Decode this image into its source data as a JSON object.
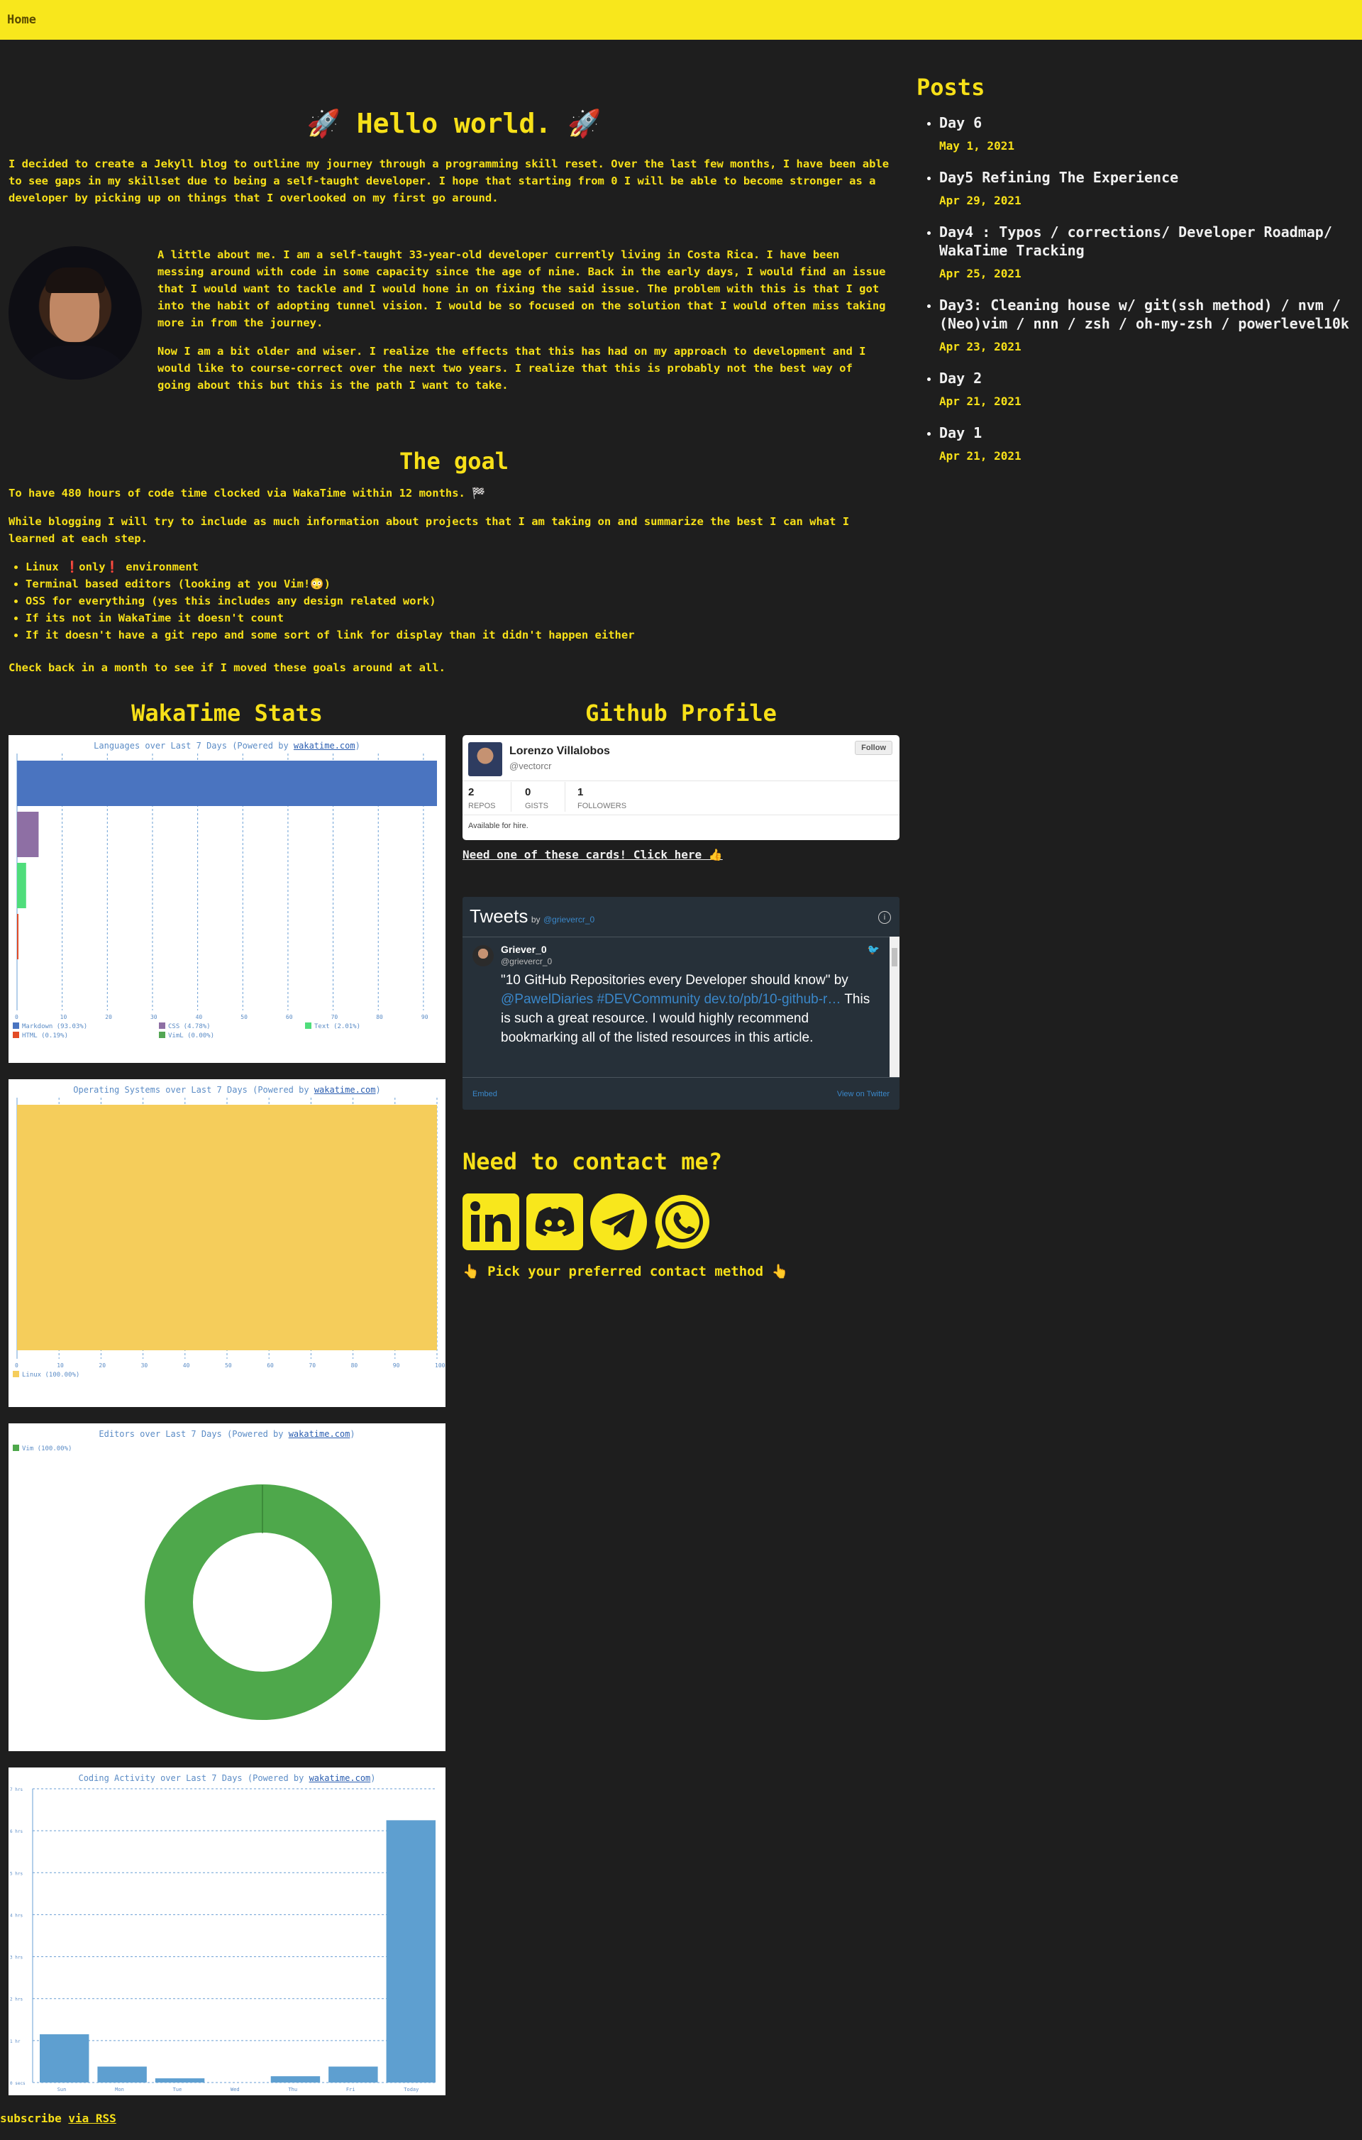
{
  "nav": {
    "home_label": "Home"
  },
  "main": {
    "title": "🚀 Hello world. 🚀",
    "intro": "I decided to create a Jekyll blog to outline my journey through a programming skill reset. Over the last few months, I have been able to see gaps in my skillset due to being a self-taught developer. I hope that starting from 0 I will be able to become stronger as a developer by picking up on things that I overlooked on my first go around.",
    "about_1": "A little about me. I am a self-taught 33-year-old developer currently living in Costa Rica. I have been messing around with code in some capacity since the age of nine. Back in the early days, I would find an issue that I would want to tackle and I would hone in on fixing the said issue. The problem with this is that I got into the habit of adopting tunnel vision. I would be so focused on the solution that I would often miss taking more in from the journey.",
    "about_2": "Now I am a bit older and wiser. I realize the effects that this has had on my approach to development and I would like to course-correct over the next two years. I realize that this is probably not the best way of going about this but this is the path I want to take.",
    "goal_heading": "The goal",
    "goal_text": "To have 480 hours of code time clocked via WakaTime within 12 months. 🏁",
    "blog_text": "While blogging I will try to include as much information about projects that I am taking on and summarize the best I can what I learned at each step.",
    "goals": [
      "Linux ❗only❗ environment",
      "Terminal based editors (looking at you Vim!😳)",
      "OSS for everything (yes this includes any design related work)",
      "If its not in WakaTime it doesn't count",
      "If it doesn't have a git repo and some sort of link for display than it didn't happen either"
    ],
    "check_back": "Check back in a month to see if I moved these goals around at all."
  },
  "wakatime": {
    "heading": "WakaTime Stats",
    "languages_title": "Languages over Last 7 Days (Powered by ",
    "os_title": "Operating Systems over Last 7 Days (Powered by ",
    "editors_title": "Editors over Last 7 Days (Powered by ",
    "activity_title": "Coding Activity over Last 7 Days (Powered by ",
    "link_text": "wakatime.com",
    "close_paren": ")"
  },
  "chart_data": [
    {
      "type": "bar",
      "title": "Languages over Last 7 Days (Powered by wakatime.com)",
      "orientation": "horizontal",
      "categories": [
        "Markdown",
        "CSS",
        "Text",
        "HTML",
        "VimL"
      ],
      "values": [
        93.03,
        4.78,
        2.01,
        0.19,
        0.0
      ],
      "legend": [
        "Markdown (93.03%)",
        "CSS (4.78%)",
        "Text (2.01%)",
        "HTML (0.19%)",
        "VimL (0.00%)"
      ],
      "colors": [
        "#4a74c0",
        "#8e6fa4",
        "#4fdd7b",
        "#e34c26",
        "#53a653"
      ],
      "xlim": [
        0,
        93
      ],
      "xticks": [
        "0",
        "10",
        "20",
        "30",
        "40",
        "50",
        "60",
        "70",
        "80",
        "90"
      ]
    },
    {
      "type": "bar",
      "title": "Operating Systems over Last 7 Days (Powered by wakatime.com)",
      "orientation": "horizontal",
      "categories": [
        "Linux"
      ],
      "values": [
        100.0
      ],
      "legend": [
        "Linux (100.00%)"
      ],
      "colors": [
        "#f5cd5b"
      ],
      "xlim": [
        0,
        100
      ],
      "xticks": [
        "0",
        "10",
        "20",
        "30",
        "40",
        "50",
        "60",
        "70",
        "80",
        "90",
        "100"
      ]
    },
    {
      "type": "pie",
      "title": "Editors over Last 7 Days (Powered by wakatime.com)",
      "categories": [
        "Vim"
      ],
      "values": [
        100.0
      ],
      "legend": [
        "Vim (100.00%)"
      ],
      "colors": [
        "#4ea84b"
      ]
    },
    {
      "type": "bar",
      "title": "Coding Activity over Last 7 Days (Powered by wakatime.com)",
      "categories": [
        "Sun",
        "Mon",
        "Tue",
        "Wed",
        "Thu",
        "Fri",
        "Today"
      ],
      "values": [
        1.15,
        0.38,
        0.1,
        0.0,
        0.15,
        0.38,
        6.25
      ],
      "ylim": [
        0,
        7
      ],
      "yticks": [
        "0 secs",
        "1 hr",
        "2 hrs",
        "3 hrs",
        "4 hrs",
        "5 hrs",
        "6 hrs",
        "7 hrs"
      ],
      "color": "#5e9fd0"
    }
  ],
  "github": {
    "heading": "Github Profile",
    "name": "Lorenzo Villalobos",
    "handle": "@vectorcr",
    "follow": "Follow",
    "repos": "2",
    "repos_label": "REPOS",
    "gists": "0",
    "gists_label": "GISTS",
    "followers": "1",
    "followers_label": "FOLLOWERS",
    "bio": "Available for hire.",
    "card_link": "Need one of these cards! Click here 👍"
  },
  "tweets": {
    "title": "Tweets",
    "by": "by",
    "by_handle": "@grievercr_0",
    "author": "Griever_0",
    "author_handle": "@grievercr_0",
    "text_start": "\"10 GitHub Repositories every Developer should know\" by",
    "mention": "@PawelDiaries",
    "hashtag": "#DEVCommunity",
    "link": "dev.to/pb/10-github-r…",
    "text_end": "This is such a great resource. I would highly recommend bookmarking all of the listed resources in this article.",
    "embed": "Embed",
    "view": "View on Twitter"
  },
  "contact": {
    "heading": "Need to contact me?",
    "pick": "👆 Pick your preferred contact method 👆",
    "icons": [
      "linkedin-icon",
      "discord-icon",
      "telegram-icon",
      "whatsapp-icon"
    ]
  },
  "posts": {
    "heading": "Posts",
    "items": [
      {
        "title": "Day 6",
        "date": "May 1, 2021"
      },
      {
        "title": "Day5 Refining The Experience",
        "date": "Apr 29, 2021"
      },
      {
        "title": "Day4 : Typos / corrections/ Developer Roadmap/ WakaTime Tracking",
        "date": "Apr 25, 2021"
      },
      {
        "title": "Day3: Cleaning house w/ git(ssh method) / nvm / (Neo)vim / nnn / zsh / oh-my-zsh / powerlevel10k",
        "date": "Apr 23, 2021"
      },
      {
        "title": "Day 2",
        "date": "Apr 21, 2021"
      },
      {
        "title": "Day 1",
        "date": "Apr 21, 2021"
      }
    ]
  },
  "footer": {
    "subscribe": "subscribe",
    "rss": "via RSS"
  },
  "colors": {
    "accent": "#f7e018",
    "background": "#1e1e1e"
  }
}
